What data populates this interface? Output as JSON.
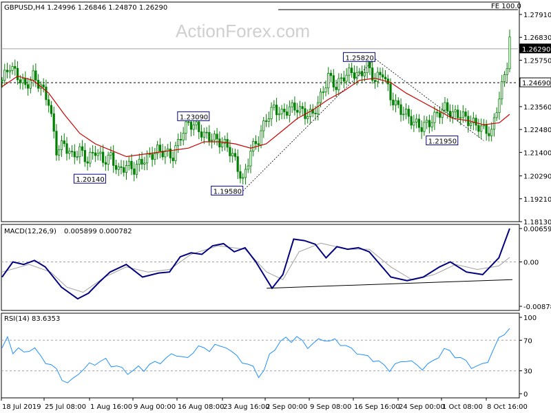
{
  "title": "GBPUSD,H4  1.24996 1.26846 1.24870 1.26290",
  "watermark": "ActionForex.com",
  "colors": {
    "candle": "#008000",
    "ma": "#cc0000",
    "macd": "#000080",
    "signal": "#a0a0a0",
    "rsi": "#1e90ff",
    "trend": "#000000",
    "level": "#000000"
  },
  "chart_data": [
    {
      "type": "candlestick",
      "name": "price",
      "ylim": [
        1.1813,
        1.2791
      ],
      "y_ticks": [
        "1.27910",
        "1.26830",
        "1.25750",
        "1.24690",
        "1.23560",
        "1.22480",
        "1.21400",
        "1.20290",
        "1.19210",
        "1.18130"
      ],
      "price_labels": [
        "1.26290",
        "1.24690"
      ],
      "last_price": 1.2629,
      "hline": 1.2469,
      "fe_label": "FE 100.0",
      "fe_level": 1.2791,
      "annotations": [
        {
          "label": "1.25820",
          "price": 1.2582
        },
        {
          "label": "1.23090",
          "price": 1.2309
        },
        {
          "label": "1.20140",
          "price": 1.2014
        },
        {
          "label": "1.19580",
          "price": 1.1958
        },
        {
          "label": "1.21950",
          "price": 1.2195
        }
      ],
      "close_path": [
        [
          0,
          1.248
        ],
        [
          3,
          1.255
        ],
        [
          6,
          1.25
        ],
        [
          9,
          1.245
        ],
        [
          12,
          1.25
        ],
        [
          15,
          1.245
        ],
        [
          18,
          1.238
        ],
        [
          21,
          1.215
        ],
        [
          24,
          1.218
        ],
        [
          27,
          1.212
        ],
        [
          30,
          1.215
        ],
        [
          33,
          1.21
        ],
        [
          36,
          1.215
        ],
        [
          39,
          1.21
        ],
        [
          42,
          1.212
        ],
        [
          45,
          1.205
        ],
        [
          48,
          1.208
        ],
        [
          51,
          1.206
        ],
        [
          54,
          1.21
        ],
        [
          57,
          1.212
        ],
        [
          60,
          1.215
        ],
        [
          63,
          1.214
        ],
        [
          66,
          1.212
        ],
        [
          69,
          1.222
        ],
        [
          72,
          1.228
        ],
        [
          75,
          1.226
        ],
        [
          78,
          1.222
        ],
        [
          81,
          1.221
        ],
        [
          84,
          1.219
        ],
        [
          87,
          1.217
        ],
        [
          90,
          1.21
        ],
        [
          93,
          1.2
        ],
        [
          96,
          1.215
        ],
        [
          99,
          1.22
        ],
        [
          102,
          1.23
        ],
        [
          105,
          1.235
        ],
        [
          108,
          1.232
        ],
        [
          111,
          1.235
        ],
        [
          114,
          1.235
        ],
        [
          117,
          1.232
        ],
        [
          120,
          1.232
        ],
        [
          123,
          1.24
        ],
        [
          126,
          1.25
        ],
        [
          129,
          1.245
        ],
        [
          132,
          1.25
        ],
        [
          135,
          1.252
        ],
        [
          138,
          1.25
        ],
        [
          141,
          1.255
        ],
        [
          144,
          1.248
        ],
        [
          147,
          1.252
        ],
        [
          150,
          1.24
        ],
        [
          153,
          1.235
        ],
        [
          156,
          1.232
        ],
        [
          159,
          1.228
        ],
        [
          162,
          1.226
        ],
        [
          165,
          1.228
        ],
        [
          168,
          1.232
        ],
        [
          171,
          1.235
        ],
        [
          174,
          1.232
        ],
        [
          177,
          1.232
        ],
        [
          180,
          1.229
        ],
        [
          183,
          1.227
        ],
        [
          186,
          1.225
        ],
        [
          189,
          1.223
        ],
        [
          191,
          1.235
        ],
        [
          193,
          1.245
        ],
        [
          195,
          1.256
        ],
        [
          196,
          1.268
        ]
      ],
      "ma_path": [
        [
          0,
          1.245
        ],
        [
          6,
          1.25
        ],
        [
          12,
          1.248
        ],
        [
          18,
          1.242
        ],
        [
          24,
          1.232
        ],
        [
          30,
          1.223
        ],
        [
          36,
          1.218
        ],
        [
          42,
          1.215
        ],
        [
          48,
          1.212
        ],
        [
          54,
          1.213
        ],
        [
          60,
          1.214
        ],
        [
          66,
          1.215
        ],
        [
          72,
          1.216
        ],
        [
          78,
          1.219
        ],
        [
          84,
          1.219
        ],
        [
          90,
          1.218
        ],
        [
          96,
          1.216
        ],
        [
          102,
          1.218
        ],
        [
          108,
          1.224
        ],
        [
          114,
          1.23
        ],
        [
          120,
          1.234
        ],
        [
          126,
          1.239
        ],
        [
          132,
          1.243
        ],
        [
          138,
          1.248
        ],
        [
          144,
          1.249
        ],
        [
          150,
          1.247
        ],
        [
          156,
          1.242
        ],
        [
          162,
          1.238
        ],
        [
          168,
          1.234
        ],
        [
          174,
          1.23
        ],
        [
          180,
          1.229
        ],
        [
          186,
          1.227
        ],
        [
          192,
          1.228
        ],
        [
          196,
          1.232
        ]
      ]
    },
    {
      "type": "line",
      "name": "MACD(12,26,9)",
      "header_values": "0.005899 0.000782",
      "ylim": [
        -0.00878,
        0.006598
      ],
      "y_ticks": [
        "0.006598",
        "0.00",
        "-0.00878"
      ],
      "macd_path": [
        [
          0,
          -0.003
        ],
        [
          4,
          0
        ],
        [
          8,
          -0.0005
        ],
        [
          12,
          0.0003
        ],
        [
          16,
          -0.001
        ],
        [
          22,
          -0.005
        ],
        [
          28,
          -0.0073
        ],
        [
          32,
          -0.0062
        ],
        [
          36,
          -0.004
        ],
        [
          40,
          -0.002
        ],
        [
          46,
          -0.0005
        ],
        [
          52,
          -0.003
        ],
        [
          58,
          -0.0022
        ],
        [
          62,
          -0.002
        ],
        [
          66,
          0.001
        ],
        [
          70,
          0.0018
        ],
        [
          74,
          0.0015
        ],
        [
          78,
          0.0032
        ],
        [
          82,
          0.0036
        ],
        [
          86,
          0.002
        ],
        [
          90,
          0.0028
        ],
        [
          94,
          0
        ],
        [
          100,
          -0.0052
        ],
        [
          104,
          -0.0025
        ],
        [
          108,
          0.0045
        ],
        [
          112,
          0.0042
        ],
        [
          116,
          0.0035
        ],
        [
          120,
          0.0008
        ],
        [
          124,
          0.003
        ],
        [
          128,
          0.0025
        ],
        [
          132,
          0.0028
        ],
        [
          136,
          0.002
        ],
        [
          140,
          -0.0005
        ],
        [
          144,
          -0.003
        ],
        [
          150,
          -0.0037
        ],
        [
          156,
          -0.003
        ],
        [
          162,
          -0.001
        ],
        [
          166,
          0
        ],
        [
          172,
          -0.002
        ],
        [
          178,
          -0.0025
        ],
        [
          184,
          0.0008
        ],
        [
          188,
          0.006598
        ]
      ],
      "signal_path": [
        [
          0,
          -0.002
        ],
        [
          10,
          -0.0005
        ],
        [
          18,
          -0.002
        ],
        [
          24,
          -0.005
        ],
        [
          30,
          -0.006
        ],
        [
          38,
          -0.003
        ],
        [
          46,
          -0.001
        ],
        [
          54,
          -0.002
        ],
        [
          62,
          -0.0015
        ],
        [
          70,
          0.0015
        ],
        [
          80,
          0.0032
        ],
        [
          90,
          0.0025
        ],
        [
          98,
          -0.002
        ],
        [
          104,
          -0.0035
        ],
        [
          110,
          0.002
        ],
        [
          118,
          0.0037
        ],
        [
          128,
          0.0025
        ],
        [
          136,
          0.0025
        ],
        [
          144,
          -0.001
        ],
        [
          152,
          -0.0036
        ],
        [
          160,
          -0.0025
        ],
        [
          168,
          -0.0005
        ],
        [
          176,
          -0.0015
        ],
        [
          184,
          -0.0008
        ],
        [
          188,
          0.0009
        ]
      ],
      "trendline": [
        [
          98,
          -0.0052
        ],
        [
          189,
          -0.0035
        ]
      ]
    },
    {
      "type": "line",
      "name": "RSI(14)",
      "header_values": "83.6353",
      "ylim": [
        0,
        100
      ],
      "y_ticks": [
        "100",
        "70",
        "30",
        "0"
      ],
      "levels": [
        70,
        30
      ],
      "values": [
        60,
        72,
        55,
        60,
        52,
        58,
        60,
        48,
        42,
        38,
        30,
        20,
        14,
        18,
        28,
        32,
        38,
        40,
        42,
        44,
        38,
        36,
        32,
        28,
        30,
        34,
        32,
        38,
        40,
        42,
        46,
        50,
        52,
        48,
        45,
        56,
        62,
        58,
        58,
        64,
        60,
        63,
        55,
        48,
        43,
        38,
        34,
        24,
        30,
        50,
        60,
        68,
        72,
        70,
        74,
        68,
        62,
        65,
        70,
        72,
        68,
        70,
        66,
        62,
        58,
        55,
        50,
        48,
        45,
        42,
        36,
        32,
        38,
        40,
        45,
        42,
        36,
        34,
        38,
        42,
        50,
        58,
        55,
        50,
        46,
        42,
        36,
        35,
        38,
        44,
        56,
        72,
        80,
        84
      ]
    }
  ],
  "x_ticks": [
    "18 Jul 2019",
    "25 Jul 08:00",
    "1 Aug 16:00",
    "9 Aug 00:00",
    "16 Aug 08:00",
    "23 Aug 16:00",
    "2 Sep 00:00",
    "9 Sep 08:00",
    "16 Sep 16:00",
    "24 Sep 00:00",
    "1 Oct 08:00",
    "8 Oct 16:00"
  ]
}
